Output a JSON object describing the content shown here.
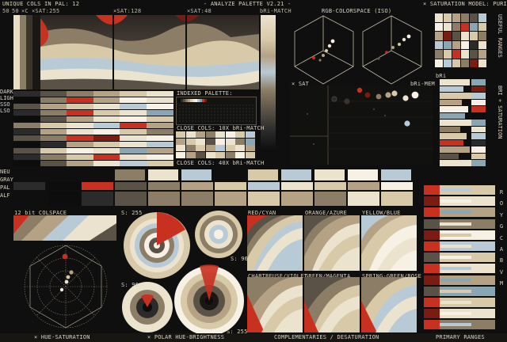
{
  "header": {
    "unique_cols": "UNIQUE COLS IN PAL: 12",
    "title": "- ANALYZE PALETTE V2.21 -",
    "sat_model": "× SATURATION MODEL: PURIT",
    "sat_labels": [
      "50",
      "50",
      "×C",
      "×SAT:255"
    ],
    "sat_mid": "×SAT:128",
    "sat_low": "×SAT:48",
    "bri_match": "bRi-MATCH"
  },
  "rgb_colorspace": {
    "title": "RGB-COLORSPACE (ISO)"
  },
  "useful_ranges": {
    "label": "USEFUL RANGES"
  },
  "scatter": {
    "x_label": "× SAT",
    "y_label": "bRi-MEM"
  },
  "bri": {
    "label": "bRi"
  },
  "right_side": {
    "label": "BRI + SATURATION"
  },
  "left_labels": {
    "labels_top": [
      "DARK",
      "LIGHT",
      "SSO",
      "LSO"
    ],
    "labels_mid": [
      "NEU",
      "GRAY",
      "PAL",
      "ALF"
    ]
  },
  "indexed": {
    "title": "INDEXED PALETTE:",
    "close_cols_10": "CLOSE COLS: 10X bRi-MATCH",
    "close_cols_40": "CLOSE COLS: 40X bRi-MATCH"
  },
  "colspace12": {
    "title": "12 bit COLSPACE"
  },
  "polar": {
    "s255a": "S: 255",
    "s96a": "S: 96",
    "s96b": "S: 96",
    "s255b": "S: 255"
  },
  "gradients": {
    "red_cyan": "RED/CYAN",
    "orange_azure": "ORANGE/AZURE",
    "yellow_blue": "YELLOW/BLUE",
    "chartreuse_violet": "CHARTREUSE/VIOLET",
    "green_magenta": "GREEN/MAGENTA",
    "spring_rose": "SPRING-GREEN/ROSE"
  },
  "primary": {
    "letters": [
      "R",
      "O",
      "Y",
      "G",
      "C",
      "A",
      "B",
      "V",
      "M"
    ]
  },
  "footer": {
    "hue_sat": "× HUE-SATURATION",
    "polar_hue_bri": "× POLAR HUE-BRIGHTNESS",
    "complementaries": "COMPLEMENTARIES / DESATURATION",
    "primary_ranges": "PRIMARY RANGES"
  },
  "palette": {
    "colors": [
      "#0d0d0d",
      "#2b2b2b",
      "#5a5246",
      "#8c7d66",
      "#b5a184",
      "#d8c9a8",
      "#ece3cf",
      "#f6f1e4",
      "#b8cad6",
      "#8aa5b4",
      "#c8301f",
      "#7a1c12"
    ]
  }
}
